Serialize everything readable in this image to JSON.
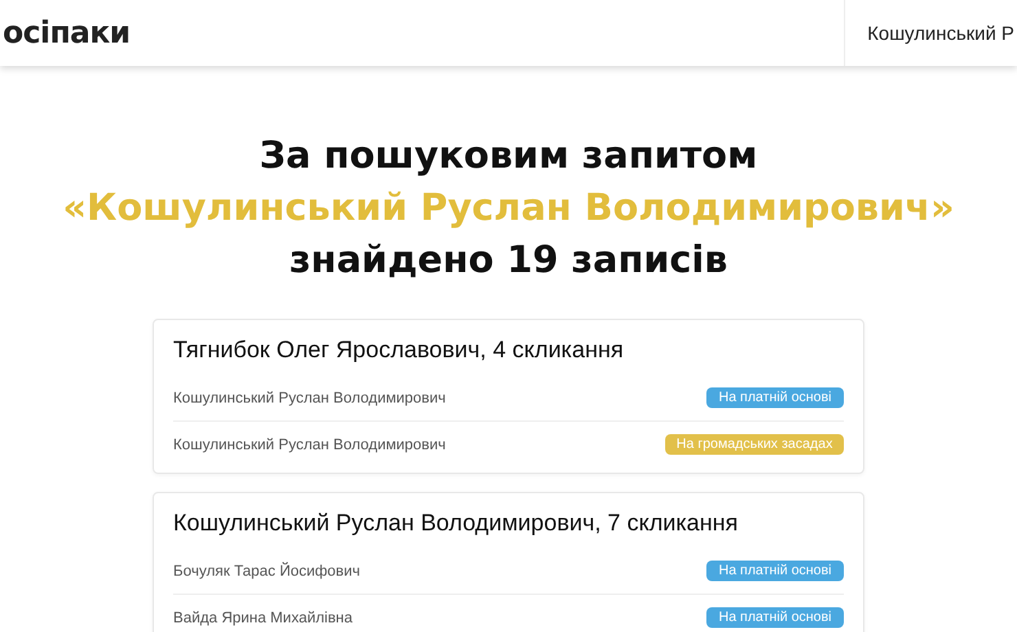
{
  "header": {
    "logo": "осіпаки",
    "search": {
      "value": "Кошулинський Р"
    }
  },
  "heading": {
    "line_1": "За пошуковим запитом",
    "query": "«Кошулинський Руслан Володимирович»",
    "line_3": "знайдено 19 записів"
  },
  "cards": [
    {
      "title": "Тягнибок Олег Ярославович, 4 скликання",
      "rows": [
        {
          "name": "Кошулинський Руслан Володимирович",
          "badge": {
            "kind": "paid",
            "label": "На платній основі"
          }
        },
        {
          "name": "Кошулинський Руслан Володимирович",
          "badge": {
            "kind": "volunteer",
            "label": "На громадських засадах"
          }
        }
      ]
    },
    {
      "title": "Кошулинський Руслан Володимирович, 7 скликання",
      "rows": [
        {
          "name": "Бочуляк Тарас Йосифович",
          "badge": {
            "kind": "paid",
            "label": "На платній основі"
          }
        },
        {
          "name": "Вайда Ярина Михайлівна",
          "badge": {
            "kind": "paid",
            "label": "На платній основі"
          }
        }
      ]
    }
  ]
}
